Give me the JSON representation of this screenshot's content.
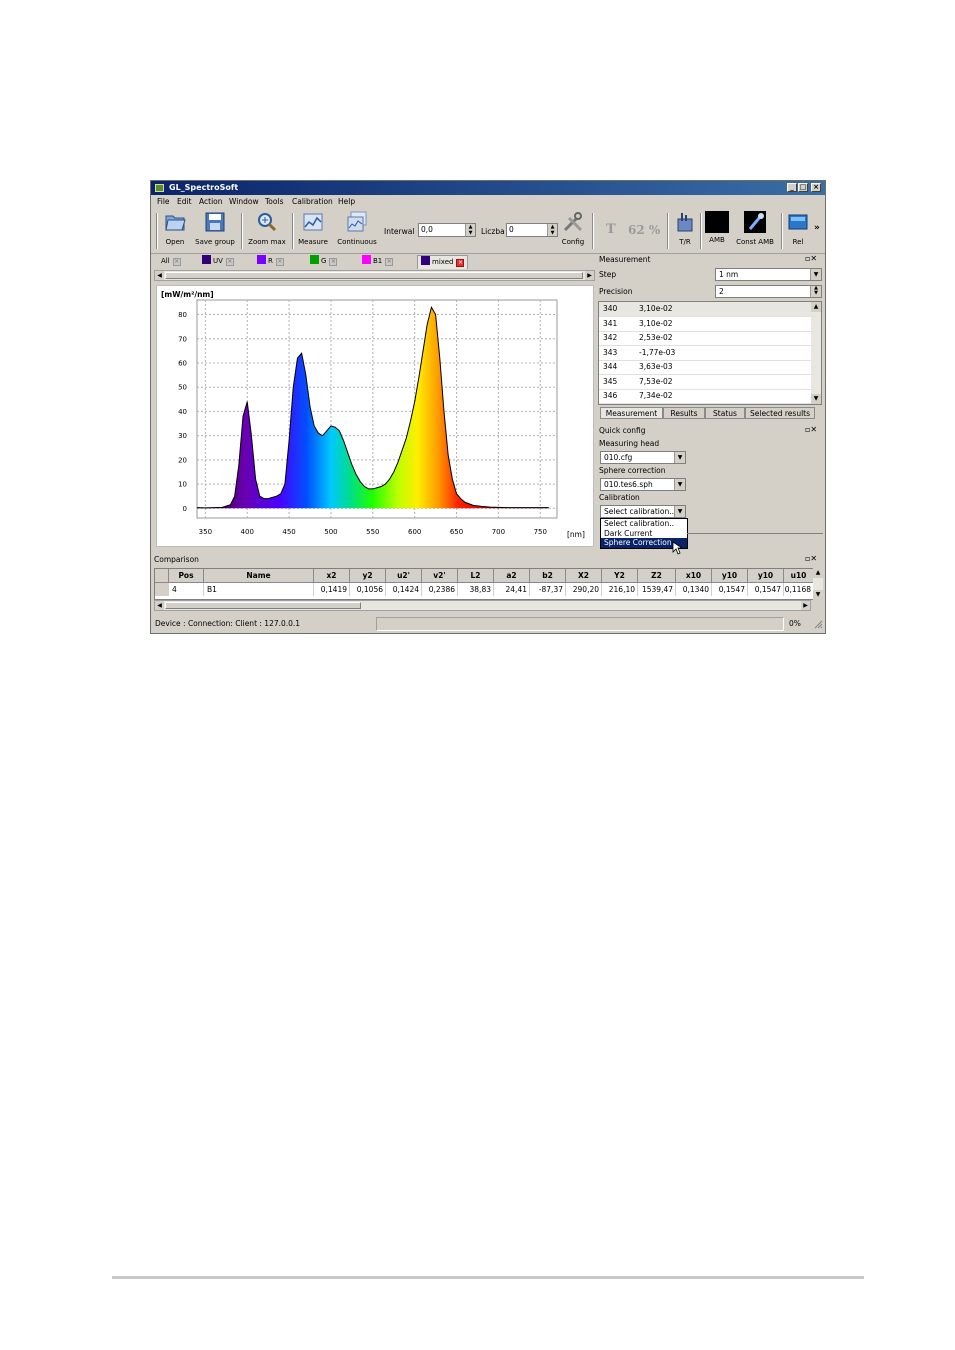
{
  "window": {
    "title": "GL_SpectroSoft"
  },
  "menu": [
    "File",
    "Edit",
    "Action",
    "Window",
    "Tools",
    "Calibration",
    "Help"
  ],
  "toolbar": {
    "open": "Open",
    "save_group": "Save group",
    "zoom_max": "Zoom max",
    "measure": "Measure",
    "continuous": "Continuous",
    "interval_label": "Interwal",
    "interval_value": "0,0",
    "count_label": "Liczba",
    "count_value": "0",
    "config": "Config",
    "t_label": "T",
    "t_value": "62 %",
    "tr": "T/R",
    "amb": "AMB",
    "const_amb": "Const AMB",
    "rel": "Rel",
    "more": "»"
  },
  "tabs": [
    {
      "label": "All",
      "color": ""
    },
    {
      "label": "UV",
      "color": "#330077"
    },
    {
      "label": "R",
      "color": "#7a00ff"
    },
    {
      "label": "G",
      "color": "#00a000"
    },
    {
      "label": "B1",
      "color": "#ff00ff"
    },
    {
      "label": "mixed",
      "color": "#33007a"
    }
  ],
  "chart_data": {
    "type": "area",
    "ylabel": "[mW/m²/nm]",
    "xlabel": "[nm]",
    "xlim": [
      340,
      770
    ],
    "ylim": [
      -4,
      86
    ],
    "xticks": [
      "350",
      "400",
      "450",
      "500",
      "550",
      "600",
      "650",
      "700",
      "750"
    ],
    "yticks": [
      "0",
      "10",
      "20",
      "30",
      "40",
      "50",
      "60",
      "70",
      "80"
    ],
    "grid": true,
    "series": [
      {
        "x": [
          340,
          350,
          360,
          370,
          380,
          385,
          390,
          395,
          400,
          405,
          410,
          415,
          420,
          425,
          430,
          435,
          440,
          445,
          450,
          455,
          460,
          465,
          470,
          475,
          480,
          485,
          490,
          495,
          500,
          505,
          510,
          515,
          520,
          525,
          530,
          535,
          540,
          545,
          550,
          555,
          560,
          565,
          570,
          575,
          580,
          585,
          590,
          595,
          600,
          605,
          610,
          615,
          620,
          625,
          630,
          635,
          640,
          645,
          650,
          655,
          660,
          670,
          680,
          690,
          700,
          710,
          720,
          730,
          740,
          750,
          760
        ],
        "y": [
          0.3,
          0.2,
          0.3,
          0.4,
          1.5,
          5,
          18,
          38,
          44,
          30,
          12,
          5,
          4,
          4,
          4.5,
          5,
          6,
          10,
          28,
          50,
          62,
          64,
          55,
          42,
          34,
          31,
          30,
          32,
          34,
          33.5,
          32,
          28,
          23,
          18,
          14,
          11,
          9,
          8,
          8,
          8.5,
          9,
          10,
          12,
          15,
          19,
          24,
          29,
          36,
          44,
          54,
          65,
          76,
          83,
          80,
          62,
          40,
          22,
          12,
          6,
          4,
          2.5,
          1.2,
          0.8,
          0.5,
          0.4,
          0.3,
          0.3,
          0.3,
          0.3,
          0.3,
          0.3
        ]
      }
    ]
  },
  "measurement": {
    "title": "Measurement",
    "step_label": "Step",
    "step_value": "1 nm",
    "precision_label": "Precision",
    "precision_value": "2",
    "rows": [
      {
        "wl": "340",
        "val": "3,10e-02"
      },
      {
        "wl": "341",
        "val": "3,10e-02"
      },
      {
        "wl": "342",
        "val": "2,53e-02"
      },
      {
        "wl": "343",
        "val": "-1,77e-03"
      },
      {
        "wl": "344",
        "val": "3,63e-03"
      },
      {
        "wl": "345",
        "val": "7,53e-02"
      },
      {
        "wl": "346",
        "val": "7,34e-02"
      }
    ],
    "tabs": [
      "Measurement",
      "Results",
      "Status",
      "Selected results"
    ]
  },
  "quick_config": {
    "title": "Quick config",
    "head_label": "Measuring head",
    "head_value": "010.cfg",
    "sphere_label": "Sphere correction",
    "sphere_value": "010.tes6.sph",
    "calib_label": "Calibration",
    "calib_value": "Select calibration..",
    "calib_options": [
      "Select calibration..",
      "Dark Current",
      "Sphere Correction"
    ]
  },
  "comparison": {
    "title": "Comparison",
    "columns": [
      "Pos",
      "Name",
      "x2",
      "y2",
      "u2'",
      "v2'",
      "L2",
      "a2",
      "b2",
      "X2",
      "Y2",
      "Z2",
      "x10",
      "y10",
      "y10",
      "u10"
    ],
    "row": [
      "4",
      "B1",
      "0,1419",
      "0,1056",
      "0,1424",
      "0,2386",
      "38,83",
      "24,41",
      "-87,37",
      "290,20",
      "216,10",
      "1539,47",
      "0,1340",
      "0,1547",
      "0,1547",
      "0,1168"
    ]
  },
  "status": {
    "text": "Device : Connection: Client : 127.0.0.1",
    "percent": "0%"
  },
  "colors": {
    "title_bar": "#0a246a",
    "highlight": "#0a246a"
  }
}
